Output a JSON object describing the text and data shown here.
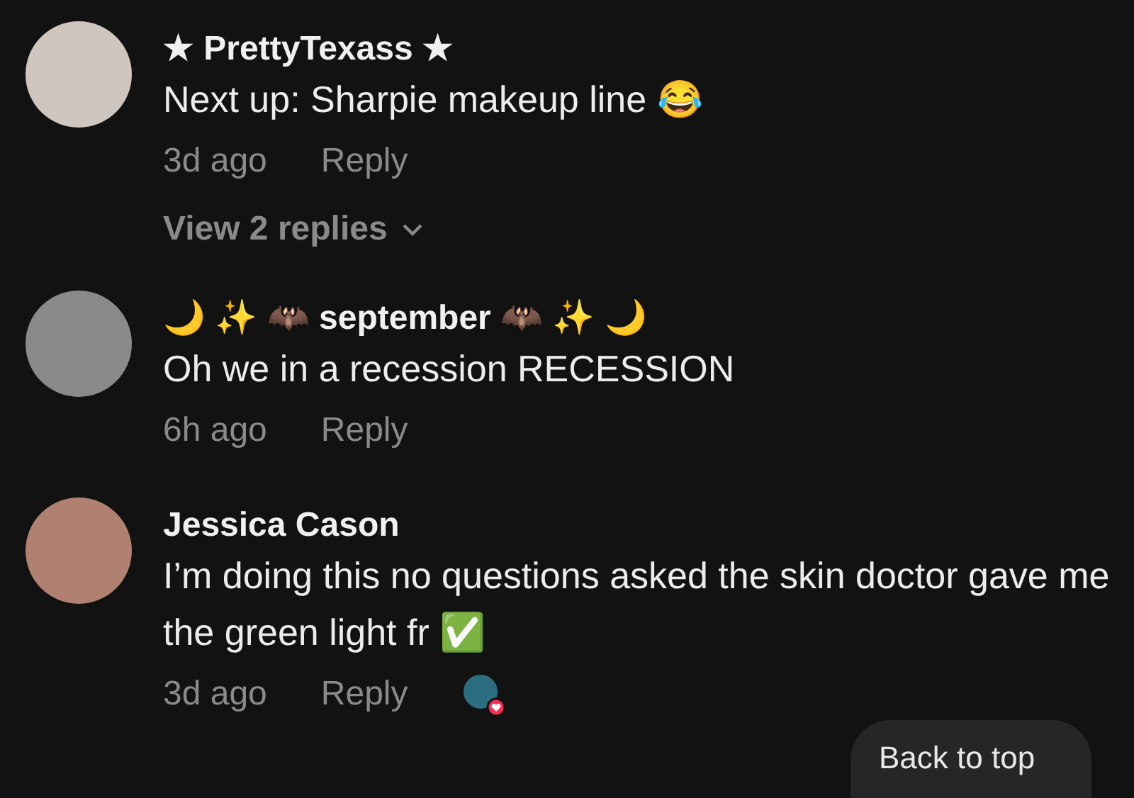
{
  "comments": [
    {
      "author": "★ PrettyTexass ★",
      "text": "Next up: Sharpie makeup line 😂",
      "time": "3d ago",
      "reply": "Reply",
      "view_replies": "View 2 replies",
      "liked_by_creator": false
    },
    {
      "author": "🌙 ✨ 🦇 september 🦇 ✨ 🌙",
      "text": "Oh we in a recession RECESSION",
      "time": "6h ago",
      "reply": "Reply",
      "liked_by_creator": false
    },
    {
      "author": "Jessica Cason",
      "text": "I’m doing this no questions asked the skin doctor gave me the green light fr ✅",
      "time": "3d ago",
      "reply": "Reply",
      "liked_by_creator": true
    }
  ],
  "back_to_top": "Back to top"
}
